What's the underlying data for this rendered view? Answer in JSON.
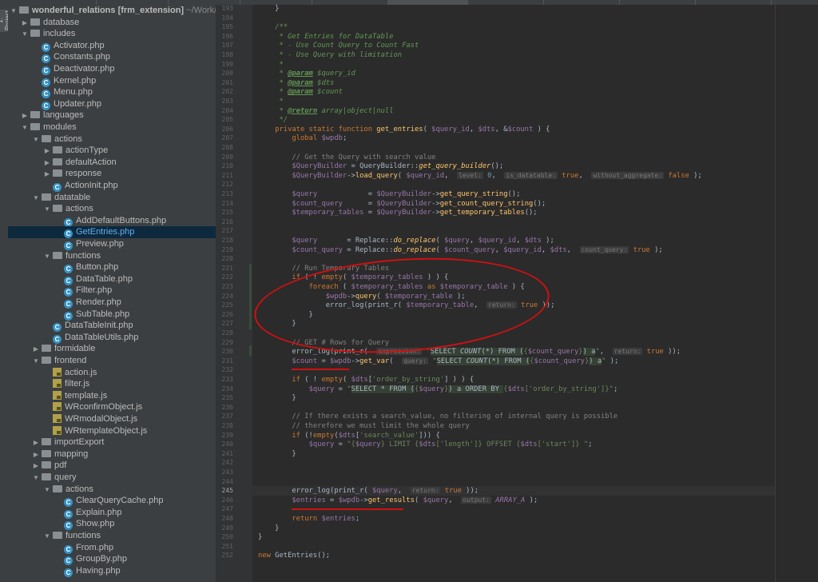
{
  "tree": {
    "rows": [
      {
        "label": "wonderful_relations [frm_extension]",
        "suffix": " ~/Work/",
        "type": "root",
        "indent": 0,
        "open": true
      },
      {
        "label": "database",
        "type": "folder",
        "indent": 1,
        "open": false
      },
      {
        "label": "includes",
        "type": "folder",
        "indent": 1,
        "open": true
      },
      {
        "label": "Activator.php",
        "type": "php",
        "indent": 2
      },
      {
        "label": "Constants.php",
        "type": "php",
        "indent": 2
      },
      {
        "label": "Deactivator.php",
        "type": "php",
        "indent": 2
      },
      {
        "label": "Kernel.php",
        "type": "php",
        "indent": 2
      },
      {
        "label": "Menu.php",
        "type": "php",
        "indent": 2
      },
      {
        "label": "Updater.php",
        "type": "php",
        "indent": 2
      },
      {
        "label": "languages",
        "type": "folder",
        "indent": 1,
        "open": false
      },
      {
        "label": "modules",
        "type": "folder",
        "indent": 1,
        "open": true
      },
      {
        "label": "actions",
        "type": "folder",
        "indent": 2,
        "open": true
      },
      {
        "label": "actionType",
        "type": "folder",
        "indent": 3,
        "open": false
      },
      {
        "label": "defaultAction",
        "type": "folder",
        "indent": 3,
        "open": false
      },
      {
        "label": "response",
        "type": "folder",
        "indent": 3,
        "open": false
      },
      {
        "label": "ActionInit.php",
        "type": "php",
        "indent": 3
      },
      {
        "label": "datatable",
        "type": "folder",
        "indent": 2,
        "open": true
      },
      {
        "label": "actions",
        "type": "folder",
        "indent": 3,
        "open": true
      },
      {
        "label": "AddDefaultButtons.php",
        "type": "php",
        "indent": 4
      },
      {
        "label": "GetEntries.php",
        "type": "php",
        "indent": 4,
        "selected": true
      },
      {
        "label": "Preview.php",
        "type": "php",
        "indent": 4
      },
      {
        "label": "functions",
        "type": "folder",
        "indent": 3,
        "open": true
      },
      {
        "label": "Button.php",
        "type": "php",
        "indent": 4
      },
      {
        "label": "DataTable.php",
        "type": "php",
        "indent": 4
      },
      {
        "label": "Filter.php",
        "type": "php",
        "indent": 4
      },
      {
        "label": "Render.php",
        "type": "php",
        "indent": 4
      },
      {
        "label": "SubTable.php",
        "type": "php",
        "indent": 4
      },
      {
        "label": "DataTableInit.php",
        "type": "php",
        "indent": 3
      },
      {
        "label": "DataTableUtils.php",
        "type": "php",
        "indent": 3
      },
      {
        "label": "formidable",
        "type": "folder",
        "indent": 2,
        "open": false
      },
      {
        "label": "frontend",
        "type": "folder",
        "indent": 2,
        "open": true
      },
      {
        "label": "action.js",
        "type": "js",
        "indent": 3
      },
      {
        "label": "filter.js",
        "type": "js",
        "indent": 3
      },
      {
        "label": "template.js",
        "type": "js",
        "indent": 3
      },
      {
        "label": "WRconfirmObject.js",
        "type": "js",
        "indent": 3
      },
      {
        "label": "WRmodalObject.js",
        "type": "js",
        "indent": 3
      },
      {
        "label": "WRtemplateObject.js",
        "type": "js",
        "indent": 3
      },
      {
        "label": "importExport",
        "type": "folder",
        "indent": 2,
        "open": false
      },
      {
        "label": "mapping",
        "type": "folder",
        "indent": 2,
        "open": false
      },
      {
        "label": "pdf",
        "type": "folder",
        "indent": 2,
        "open": false
      },
      {
        "label": "query",
        "type": "folder",
        "indent": 2,
        "open": true
      },
      {
        "label": "actions",
        "type": "folder",
        "indent": 3,
        "open": true
      },
      {
        "label": "ClearQueryCache.php",
        "type": "php",
        "indent": 4
      },
      {
        "label": "Explain.php",
        "type": "php",
        "indent": 4
      },
      {
        "label": "Show.php",
        "type": "php",
        "indent": 4
      },
      {
        "label": "functions",
        "type": "folder",
        "indent": 3,
        "open": true
      },
      {
        "label": "From.php",
        "type": "php",
        "indent": 4
      },
      {
        "label": "GroupBy.php",
        "type": "php",
        "indent": 4
      },
      {
        "label": "Having.php",
        "type": "php",
        "indent": 4
      }
    ],
    "project_tab_label": "1: Project",
    "php_icon_letter": "C"
  },
  "editor": {
    "current_line": 245,
    "lines": [
      {
        "n": 193,
        "html": "    }"
      },
      {
        "n": 194,
        "html": ""
      },
      {
        "n": 195,
        "html": "    <span class='doc'>/**</span>"
      },
      {
        "n": 196,
        "html": "     <span class='doc'>* Get Entries for DataTable</span>"
      },
      {
        "n": 197,
        "html": "     <span class='doc'>* - Use Count Query to Count Fast</span>"
      },
      {
        "n": 198,
        "html": "     <span class='doc'>* - Use Query with limitation</span>"
      },
      {
        "n": 199,
        "html": "     <span class='doc'>*</span>"
      },
      {
        "n": 200,
        "html": "     <span class='doc'>* <span class='tag'>@param</span> $query_id</span>"
      },
      {
        "n": 201,
        "html": "     <span class='doc'>* <span class='tag'>@param</span> $dts</span>"
      },
      {
        "n": 202,
        "html": "     <span class='doc'>* <span class='tag'>@param</span> $count</span>"
      },
      {
        "n": 203,
        "html": "     <span class='doc'>*</span>"
      },
      {
        "n": 204,
        "html": "     <span class='doc'>* <span class='tag'>@return</span> array|object|null</span>"
      },
      {
        "n": 205,
        "html": "     <span class='doc'>*/</span>"
      },
      {
        "n": 206,
        "html": "    <span class='kw'>private static function</span> <span class='fn'>get_entries</span>( <span class='var'>$query_id</span>, <span class='var'>$dts</span>, &amp;<span class='var'>$count</span> ) {"
      },
      {
        "n": 207,
        "html": "        <span class='kw'>global</span> <span class='var'>$wpdb</span>;"
      },
      {
        "n": 208,
        "html": ""
      },
      {
        "n": 209,
        "html": "        <span class='cm'>// Get the Query with search value</span>"
      },
      {
        "n": 210,
        "html": "        <span class='var'>$QueryBuilder</span> = QueryBuilder::<span class='sfn'>get_query_builder</span>();"
      },
      {
        "n": 211,
        "html": "        <span class='var'>$QueryBuilder</span>-&gt;<span class='fn'>load_query</span>( <span class='var'>$query_id</span>,  <span class='hint'>level:</span> <span class='num'>0</span>,  <span class='hint'>is_datatable:</span> <span class='kw'>true</span>,  <span class='hint'>without_aggregate:</span> <span class='kw'>false</span> );"
      },
      {
        "n": 212,
        "html": ""
      },
      {
        "n": 213,
        "html": "        <span class='var'>$query</span>            = <span class='var'>$QueryBuilder</span>-&gt;<span class='fn'>get_query_string</span>();"
      },
      {
        "n": 214,
        "html": "        <span class='var'>$count_query</span>      = <span class='var'>$QueryBuilder</span>-&gt;<span class='fn'>get_count_query_string</span>();"
      },
      {
        "n": 215,
        "html": "        <span class='var'>$temporary_tables</span> = <span class='var'>$QueryBuilder</span>-&gt;<span class='fn'>get_temporary_tables</span>();"
      },
      {
        "n": 216,
        "html": ""
      },
      {
        "n": 217,
        "html": ""
      },
      {
        "n": 218,
        "html": "        <span class='var'>$query</span>       = Replace::<span class='sfn'>do_replace</span>( <span class='var'>$query</span>, <span class='var'>$query_id</span>, <span class='var'>$dts</span> );"
      },
      {
        "n": 219,
        "html": "        <span class='var'>$count_query</span> = Replace::<span class='sfn'>do_replace</span>( <span class='var'>$count_query</span>, <span class='var'>$query_id</span>, <span class='var'>$dts</span>,  <span class='hint'>count_query:</span> <span class='kw'>true</span> );"
      },
      {
        "n": 220,
        "html": ""
      },
      {
        "n": 221,
        "html": "        <span class='cm'>// Run Temporary Tables</span>"
      },
      {
        "n": 222,
        "html": "        <span class='kw'>if</span> ( ! <span class='kw'>empty</span>( <span class='var'>$temporary_tables</span> ) ) {"
      },
      {
        "n": 223,
        "html": "            <span class='kw'>foreach</span> ( <span class='var'>$temporary_tables</span> <span class='kw'>as</span> <span class='var'>$temporary_table</span> ) {"
      },
      {
        "n": 224,
        "html": "                <span class='var'>$wpdb</span>-&gt;<span class='fn'>query</span>( <span class='var'>$temporary_table</span> );"
      },
      {
        "n": 225,
        "html": "                error_log(print_r( <span class='var'>$temporary_table</span>,  <span class='hint'>return:</span> <span class='kw'>true</span> ));"
      },
      {
        "n": 226,
        "html": "            }"
      },
      {
        "n": 227,
        "html": "        }"
      },
      {
        "n": 228,
        "html": ""
      },
      {
        "n": 229,
        "html": "        <span class='cm'>// GET # Rows for Query</span>"
      },
      {
        "n": 230,
        "html": "        error_log(print_r(  <span class='hint'>expression:</span> <span class='str'>\"<span class='sql'>SELECT <i>COUNT</i>(*) FROM (</span>{<span class='var'>$count_query</span>}<span class='sql'>) a</span>\"</span>,  <span class='hint'>return:</span> <span class='kw'>true</span> ));"
      },
      {
        "n": 231,
        "html": "        <span class='var'>$count</span> = <span class='var'>$wpdb</span>-&gt;<span class='fn'>get_var</span>(  <span class='hint'>query:</span> <span class='str'>\"<span class='sql'>SELECT <i>COUNT</i>(*) FROM (</span>{<span class='var'>$count_query</span>}<span class='sql'>) a</span>\"</span> );"
      },
      {
        "n": 232,
        "html": ""
      },
      {
        "n": 233,
        "html": "        <span class='kw'>if</span> ( ! <span class='kw'>empty</span>( <span class='var'>$dts</span>[<span class='str'>'order_by_string'</span>] ) ) {"
      },
      {
        "n": 234,
        "html": "            <span class='var'>$query</span> = <span class='str'>\"<span class='sql'>SELECT * FROM (</span>{<span class='var'>$query</span>}<span class='sql'>) a ORDER BY </span>{<span class='var'>$dts</span>[<span class='str'>'order_by_string'</span>]}\"</span>;"
      },
      {
        "n": 235,
        "html": "        }"
      },
      {
        "n": 236,
        "html": ""
      },
      {
        "n": 237,
        "html": "        <span class='cm'>// If there exists a search_value, no filtering of internal query is possible</span>"
      },
      {
        "n": 238,
        "html": "        <span class='cm'>// therefore we must limit the whole query</span>"
      },
      {
        "n": 239,
        "html": "        <span class='kw'>if</span> (!<span class='kw'>empty</span>(<span class='var'>$dts</span>[<span class='str'>'search_value'</span>])) {"
      },
      {
        "n": 240,
        "html": "            <span class='var'>$query</span> = <span class='str'>\"{<span class='var'>$query</span>} LIMIT {<span class='var'>$dts</span>['length']} OFFSET {<span class='var'>$dts</span>['start']} \"</span>;"
      },
      {
        "n": 241,
        "html": "        }"
      },
      {
        "n": 242,
        "html": ""
      },
      {
        "n": 243,
        "html": ""
      },
      {
        "n": 244,
        "html": ""
      },
      {
        "n": 245,
        "html": "        error_log(print_r( <span class='var'>$query</span>,  <span class='hint'>return:</span> <span class='kw'>true</span> ));"
      },
      {
        "n": 246,
        "html": "        <span class='var'>$entries</span> = <span class='var'>$wpdb</span>-&gt;<span class='fn'>get_results</span>( <span class='var'>$query</span>,  <span class='hint'>output:</span> <span class='const'>ARRAY_A</span> );"
      },
      {
        "n": 247,
        "html": ""
      },
      {
        "n": 248,
        "html": "        <span class='kw'>return</span> <span class='var'>$entries</span>;"
      },
      {
        "n": 249,
        "html": "    }"
      },
      {
        "n": 250,
        "html": "}"
      },
      {
        "n": 251,
        "html": ""
      },
      {
        "n": 252,
        "html": "<span class='kw'>new</span> GetEntries();"
      }
    ]
  },
  "colors": {
    "annotation": "#d01010",
    "selection": "#0d293e",
    "background": "#2b2b2b"
  }
}
